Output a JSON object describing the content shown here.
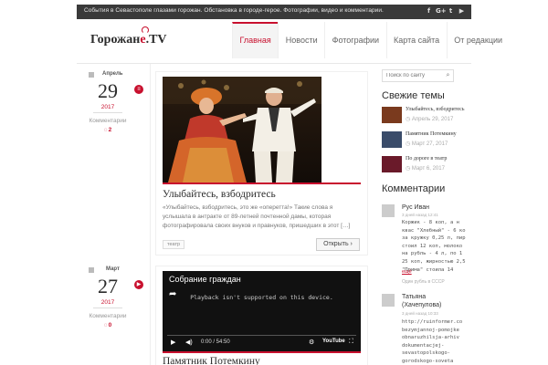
{
  "topbar": {
    "tagline": "События в Севастополе глазами горожан. Обстановка в городе-герое. Фотографии, видео и комментарии.",
    "social": [
      "f",
      "G+",
      "t",
      "▶"
    ]
  },
  "logo": {
    "main": "Горожан",
    "accent": "е",
    "suffix": ".TV"
  },
  "nav": {
    "items": [
      "Главная",
      "Новости",
      "Фотографии",
      "Карта сайта",
      "От редакции"
    ]
  },
  "posts": [
    {
      "month": "Апрель",
      "day": "29",
      "year": "2017",
      "comments_label": "Комментарии",
      "comments_count": "2",
      "title": "Улыбайтесь, взбодритесь",
      "excerpt": "«Улыбайтесь, взбодритесь, это же «оперетта!» Такие слова я услышала в антракте от 89-летней почтенной дамы, которая фотографировала своих внуков и правнуков, пришедших в этот […]",
      "tag": "театр",
      "open_label": "Открыть"
    },
    {
      "month": "Март",
      "day": "27",
      "year": "2017",
      "comments_label": "Комментарии",
      "comments_count": "0",
      "title": "Памятник Потемкину",
      "video_title": "Собрание граждан",
      "video_message": "Playback isn't supported on this device.",
      "video_time": "0:00 / 54:50",
      "video_brand": "YouTube"
    }
  ],
  "sidebar": {
    "search_placeholder": "Поиск по сайту",
    "recent_title": "Свежие темы",
    "recent": [
      {
        "title": "Улыбайтесь, взбодритесь",
        "date": "Апрель 29, 2017"
      },
      {
        "title": "Памятник Потемкину",
        "date": "Март 27, 2017"
      },
      {
        "title": "По дороге в театр",
        "date": "Март 6, 2017"
      }
    ],
    "comments_title": "Комментарии",
    "comments": [
      {
        "name": "Рус Иван",
        "when": "3 дней назад 12:41",
        "lines": [
          "Коржик - 8 коп, а н",
          "квас \"Хлебный\" - 6 ко",
          "за кружку 0,25 л, пир",
          "стоил 12 коп, молоко",
          "на рубль - 4 л, по 1",
          "25 коп, жирностью 2,5",
          "\"Прима\" стоила 14"
        ],
        "more": "ещё",
        "where": "Один рубль в СССР"
      },
      {
        "name": "Татьяна",
        "name2": "(Хачепулова)",
        "when": "3 дней назад 10:33",
        "lines": [
          "http://ruinformer.co",
          "bezymjannoj-pomojke",
          "obnaruzhilsja-arhiv",
          "dokumentacjej-",
          "sevastopolskogo-",
          "gorodskogo-soveta"
        ]
      }
    ]
  },
  "colors": {
    "accent": "#c8102e",
    "topbar": "#3a3a3a"
  }
}
